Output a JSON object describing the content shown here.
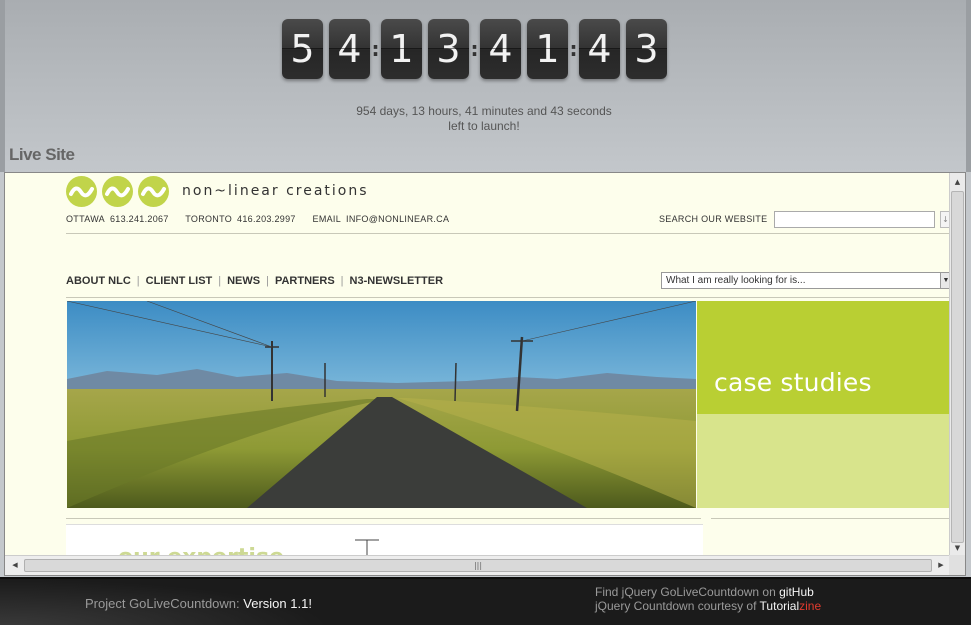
{
  "countdown": {
    "digits": [
      "5",
      "4",
      "1",
      "3",
      "4",
      "1",
      "4",
      "3"
    ],
    "separator": ":",
    "message_line1": "954 days, 13 hours, 41 minutes and 43 seconds",
    "message_line2": "left to launch!"
  },
  "section": {
    "title": "Live Site"
  },
  "site": {
    "brand": "non~linear creations",
    "contact": {
      "ottawa_label": "OTTAWA",
      "ottawa_phone": "613.241.2067",
      "toronto_label": "TORONTO",
      "toronto_phone": "416.203.2997",
      "email_label": "EMAIL",
      "email": "INFO@NONLINEAR.CA"
    },
    "search_label": "SEARCH OUR WEBSITE",
    "search_value": "",
    "nav": [
      "ABOUT NLC",
      "CLIENT LIST",
      "NEWS",
      "PARTNERS",
      "N3-NEWSLETTER"
    ],
    "select_value": "What I am really looking for is...",
    "case_studies": "case studies",
    "expertise": "our expertise"
  },
  "footer": {
    "project_prefix": "Project GoLiveCountdown:",
    "version": "Version 1.1!",
    "find_prefix": "Find jQuery GoLiveCountdown on",
    "github": "gitHub",
    "courtesy_prefix": "jQuery Countdown courtesy of",
    "tutorial": "Tutorial",
    "zine": "zine"
  },
  "colors": {
    "accent_green": "#b9cf33",
    "light_green": "#d8e48c",
    "footer_bg": "#1b1b1b",
    "zine_red": "#e23b2e"
  }
}
